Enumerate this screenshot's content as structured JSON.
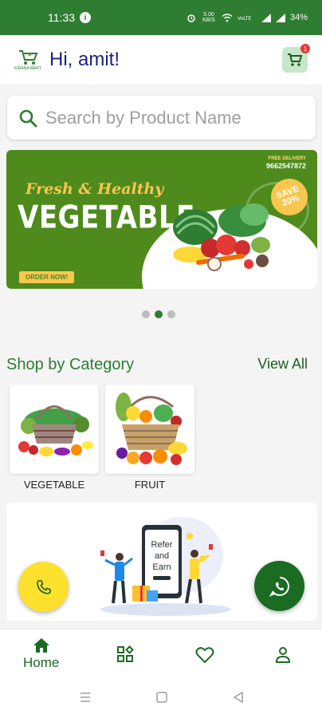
{
  "status_bar": {
    "time": "11:33",
    "network_speed": "5.00 KB/S",
    "battery": "34%",
    "info_icon": "i"
  },
  "header": {
    "logo_text": "KIRANA MART",
    "greeting": "Hi, amit!",
    "cart_count": "1"
  },
  "search": {
    "placeholder": "Search by Product Name"
  },
  "banner": {
    "tagline": "Fresh & Healthy",
    "title": "VEGETABLE",
    "cta": "ORDER NOW!",
    "delivery_label": "FREE DELIVERY",
    "phone": "9662547872",
    "save_line1": "SAVE",
    "save_line2": "20%"
  },
  "carousel": {
    "count": 3,
    "active_index": 1
  },
  "categories_section": {
    "title": "Shop by Category",
    "view_all": "View All",
    "items": [
      {
        "label": "VEGETABLE",
        "image": "vegetable-basket"
      },
      {
        "label": "FRUIT",
        "image": "fruit-basket"
      }
    ]
  },
  "refer": {
    "line1": "Refer",
    "line2": "and",
    "line3": "Earn"
  },
  "bottom_nav": {
    "items": [
      {
        "label": "Home",
        "icon": "home-icon"
      },
      {
        "label": "",
        "icon": "categories-icon"
      },
      {
        "label": "",
        "icon": "heart-icon"
      },
      {
        "label": "",
        "icon": "profile-icon"
      }
    ]
  },
  "colors": {
    "primary": "#2e7d32",
    "banner": "#4f8a1c",
    "accent_yellow": "#fde12d",
    "whatsapp": "#1b6b23"
  }
}
